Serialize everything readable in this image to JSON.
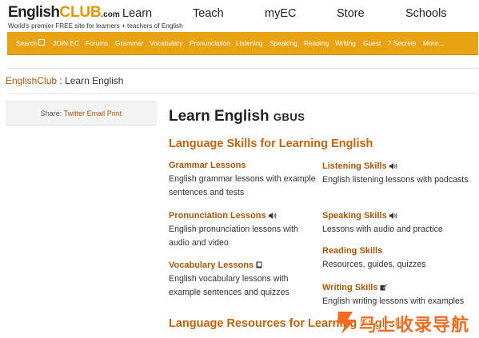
{
  "logo": {
    "english": "English",
    "club": "CLUB",
    "dotcom": ".com"
  },
  "tagline": "World's premier FREE site for learners + teachers of English",
  "topnav": [
    "Learn",
    "Teach",
    "myEC",
    "Store",
    "Schools"
  ],
  "menubar": [
    "Search",
    "JOIN EC",
    "Forums",
    "Grammar",
    "Vocabulary",
    "Pronunciation",
    "Listening",
    "Speaking",
    "Reading",
    "Writing",
    "Guest",
    "7 Secrets",
    "More..."
  ],
  "breadcrumb": {
    "home": "EnglishClub",
    "separator": " : ",
    "current": "Learn English"
  },
  "share": {
    "label": "Share:",
    "links": [
      "Twitter",
      "Email",
      "Print"
    ]
  },
  "main": {
    "title": "Learn English",
    "title_suffix": "GBUS",
    "section1_heading": "Language Skills for Learning English",
    "section2_heading": "Language Resources for Learning English",
    "skills": [
      {
        "title": "Grammar Lessons",
        "desc": "English grammar lessons with example sentences and tests",
        "icon": "none"
      },
      {
        "title": "Listening Skills",
        "desc": "English listening lessons with podcasts",
        "icon": "speaker-icon"
      },
      {
        "title": "Pronunciation Lessons",
        "desc": "English pronunciation lessons with audio and video",
        "icon": "speaker-icon"
      },
      {
        "title": "Speaking Skills",
        "desc": "Lessons with audio and practice",
        "icon": "speaker-icon"
      },
      {
        "title": "Reading Skills",
        "desc": "Resources, guides, quizzes",
        "icon": "none"
      },
      {
        "title": "Vocabulary Lessons",
        "desc": "English vocabulary lessons with example sentences and quizzes",
        "icon": "book-icon"
      },
      {
        "title": "Writing Skills",
        "desc": "English writing lessons with examples",
        "icon": "pencil-icon"
      }
    ]
  },
  "watermark": "马上收录导航",
  "colors": {
    "brand_orange": "#e8a313",
    "heading_orange": "#c2620d",
    "link_brown": "#a9560a"
  }
}
